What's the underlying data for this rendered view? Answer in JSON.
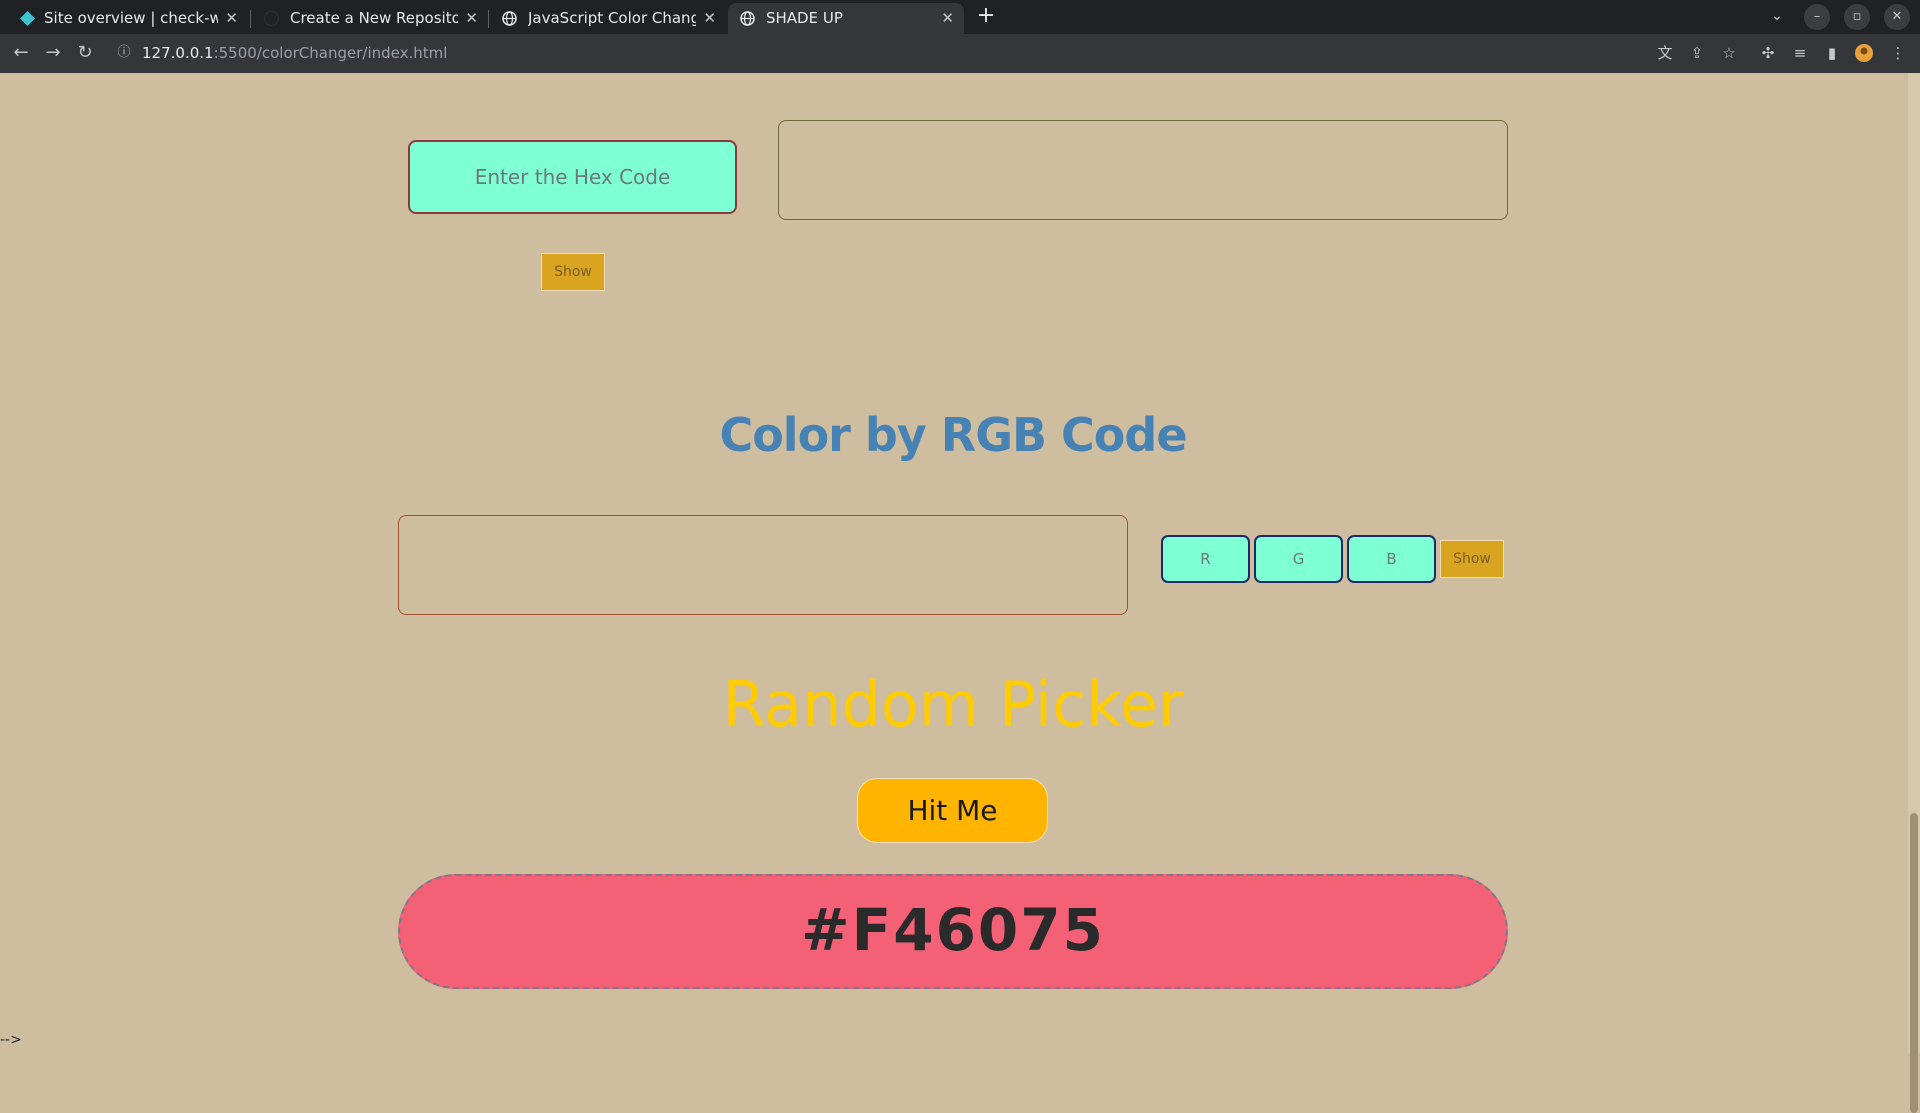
{
  "browser": {
    "tabs": [
      {
        "title": "Site overview | check-wea",
        "active": false,
        "icon": "diamond-icon"
      },
      {
        "title": "Create a New Repository",
        "active": false,
        "icon": "github-icon"
      },
      {
        "title": "JavaScript Color Changin",
        "active": false,
        "icon": "globe-icon"
      },
      {
        "title": "SHADE UP",
        "active": true,
        "icon": "globe-icon"
      }
    ],
    "url_host": "127.0.0.1",
    "url_rest": ":5500/colorChanger/index.html"
  },
  "hex_section": {
    "input_placeholder": "Enter the Hex Code",
    "show_label": "Show"
  },
  "rgb_section": {
    "heading": "Color by RGB Code",
    "r_placeholder": "R",
    "g_placeholder": "G",
    "b_placeholder": "B",
    "show_label": "Show"
  },
  "random_section": {
    "heading": "Random Picker",
    "button_label": "Hit Me",
    "result": "#F46075",
    "result_color": "#f46075"
  },
  "stray_text": "-->",
  "colors": {
    "page_bg": "#cebd9f",
    "input_bg": "#7fffd4",
    "show_btn": "#d9a520",
    "rgb_heading": "#4682b4",
    "random_heading": "#ffcc00",
    "hit_btn": "#ffb400"
  }
}
